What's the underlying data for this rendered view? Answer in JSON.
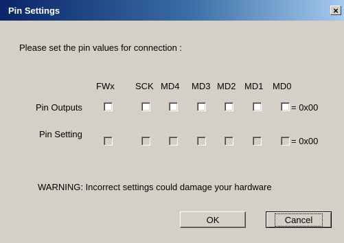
{
  "window": {
    "title": "Pin Settings",
    "close_glyph": "×"
  },
  "prompt": "Please set the pin values for connection :",
  "columns": [
    "FWx",
    "SCK",
    "MD4",
    "MD3",
    "MD2",
    "MD1",
    "MD0"
  ],
  "rows": [
    {
      "label": "Pin Outputs",
      "value": "= 0x00",
      "enabled": true,
      "checked": [
        false,
        false,
        false,
        false,
        false,
        false,
        false
      ]
    },
    {
      "label": "Pin Setting",
      "value": "= 0x00",
      "enabled": false,
      "checked": [
        false,
        false,
        false,
        false,
        false,
        false,
        false
      ]
    }
  ],
  "warning": "WARNING: Incorrect settings could damage your hardware",
  "buttons": {
    "ok": "OK",
    "cancel": "Cancel"
  }
}
